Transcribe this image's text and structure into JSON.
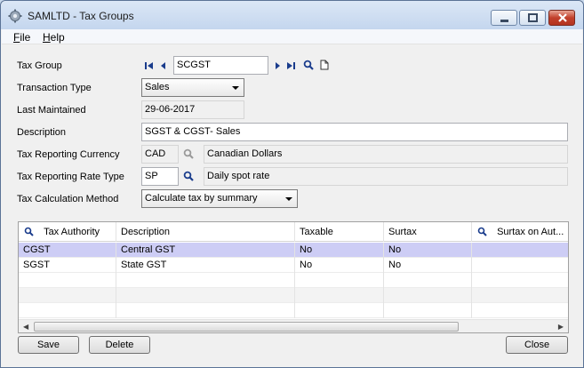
{
  "window": {
    "title": "SAMLTD - Tax Groups"
  },
  "menu": {
    "items": [
      "File",
      "Help"
    ]
  },
  "form": {
    "tax_group": {
      "label": "Tax Group",
      "value": "SCGST"
    },
    "transaction_type": {
      "label": "Transaction Type",
      "value": "Sales"
    },
    "last_maintained": {
      "label": "Last Maintained",
      "value": "29-06-2017"
    },
    "description": {
      "label": "Description",
      "value": "SGST & CGST- Sales"
    },
    "tax_reporting_currency": {
      "label": "Tax Reporting Currency",
      "code": "CAD",
      "name": "Canadian Dollars"
    },
    "tax_reporting_rate_type": {
      "label": "Tax Reporting Rate Type",
      "code": "SP",
      "name": "Daily spot rate"
    },
    "tax_calculation_method": {
      "label": "Tax Calculation Method",
      "value": "Calculate tax by summary"
    }
  },
  "grid": {
    "columns": [
      "Tax Authority",
      "Description",
      "Taxable",
      "Surtax",
      "Surtax on Aut..."
    ],
    "rows": [
      [
        "CGST",
        "Central GST",
        "No",
        "No",
        ""
      ],
      [
        "SGST",
        "State GST",
        "No",
        "No",
        ""
      ]
    ]
  },
  "buttons": {
    "save": "Save",
    "delete": "Delete",
    "close": "Close"
  },
  "icons": {
    "nav": [
      "first-record-icon",
      "previous-record-icon",
      "next-record-icon",
      "last-record-icon",
      "finder-icon",
      "new-document-icon"
    ]
  },
  "colors": {
    "selected_row": "#cdcdf5",
    "titlebar": "#c4d6ee"
  }
}
